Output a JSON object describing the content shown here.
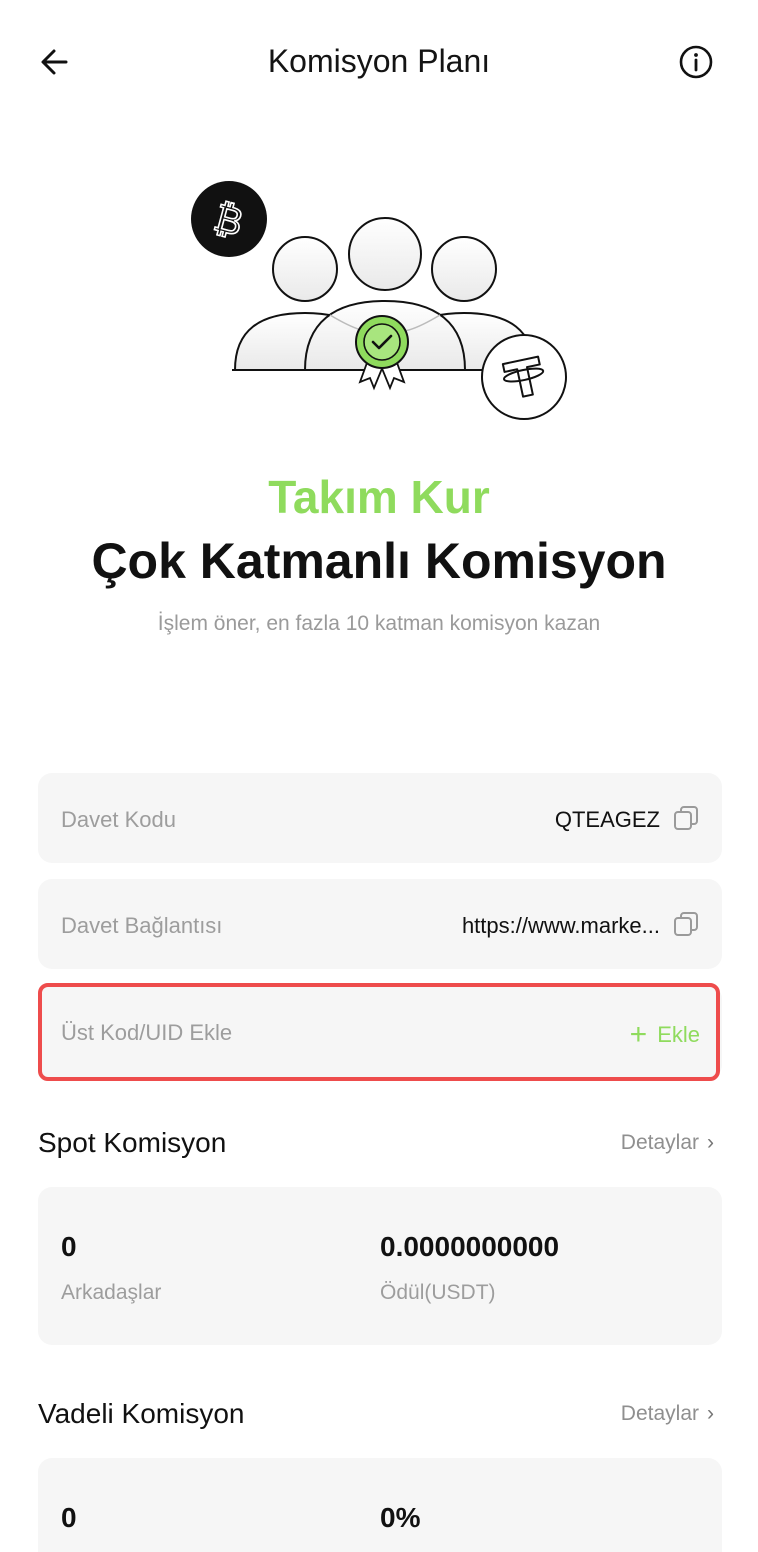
{
  "header": {
    "title": "Komisyon Planı",
    "back_icon": "arrow-left-icon",
    "info_icon": "info-circle-icon"
  },
  "hero": {
    "title_green": "Takım Kur",
    "title_main": "Çok Katmanlı Komisyon",
    "subtitle": "İşlem öner, en fazla 10 katman komisyon kazan",
    "icons": [
      "bitcoin-icon",
      "team-icon",
      "badge-check-icon",
      "tether-icon"
    ],
    "accent_color": "#8fdb5d"
  },
  "invite": {
    "code_label": "Davet Kodu",
    "code_value": "QTEAGEZ",
    "link_label": "Davet Bağlantısı",
    "link_value": "https://www.marke...",
    "copy_icon": "copy-icon"
  },
  "upper_code": {
    "label": "Üst Kod/UID Ekle",
    "add_label": "Ekle",
    "highlight_color": "#ee4c4c"
  },
  "spot": {
    "title": "Spot Komisyon",
    "details_label": "Detaylar",
    "friends_value": "0",
    "friends_label": "Arkadaşlar",
    "reward_value": "0.0000000000",
    "reward_label": "Ödül(USDT)"
  },
  "futures": {
    "title": "Vadeli Komisyon",
    "details_label": "Detaylar",
    "friends_value": "0",
    "rate_value": "0%"
  }
}
